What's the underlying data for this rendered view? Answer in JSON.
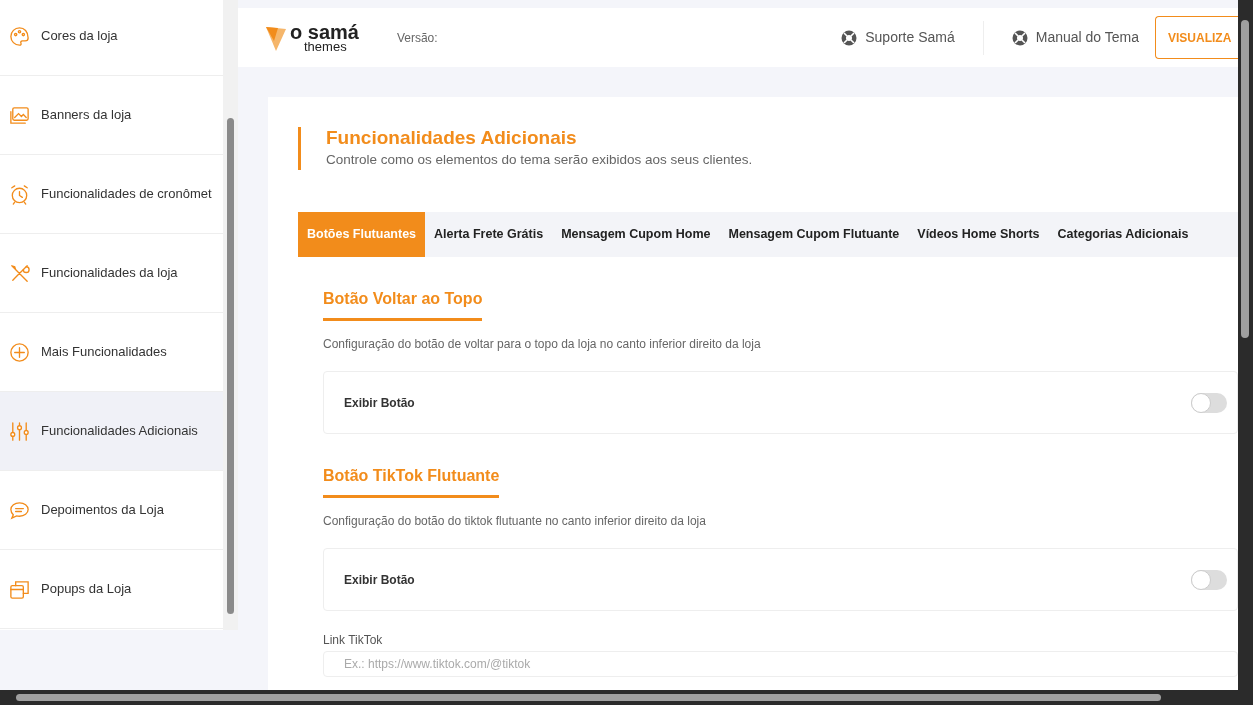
{
  "sidebar": {
    "items": [
      {
        "label": "Cores da loja",
        "selected": false
      },
      {
        "label": "Banners da loja",
        "selected": false
      },
      {
        "label": "Funcionalidades de cronômet",
        "selected": false
      },
      {
        "label": "Funcionalidades da loja",
        "selected": false
      },
      {
        "label": "Mais Funcionalidades",
        "selected": false
      },
      {
        "label": "Funcionalidades Adicionais",
        "selected": true
      },
      {
        "label": "Depoimentos da Loja",
        "selected": false
      },
      {
        "label": "Popups da Loja",
        "selected": false
      }
    ]
  },
  "header": {
    "logo": {
      "brand": "o samá",
      "sub": "themes"
    },
    "version_label": "Versão:",
    "links": [
      "Suporte Samá",
      "Manual do Tema"
    ],
    "preview_button": "VISUALIZA"
  },
  "page": {
    "title": "Funcionalidades Adicionais",
    "subtitle": "Controle como os elementos do tema serão exibidos aos seus clientes."
  },
  "tabs": [
    {
      "label": "Botões Flutuantes",
      "selected": true
    },
    {
      "label": "Alerta Frete Grátis",
      "selected": false
    },
    {
      "label": "Mensagem Cupom Home",
      "selected": false
    },
    {
      "label": "Mensagem Cupom Flutuante",
      "selected": false
    },
    {
      "label": "Vídeos Home Shorts",
      "selected": false
    },
    {
      "label": "Categorias Adicionais",
      "selected": false
    }
  ],
  "sections": [
    {
      "title": "Botão Voltar ao Topo",
      "description": "Configuração do botão de voltar para o topo da loja no canto inferior direito da loja",
      "toggle": {
        "label": "Exibir Botão",
        "on": false
      }
    },
    {
      "title": "Botão TikTok Flutuante",
      "description": "Configuração do botão do tiktok flutuante no canto inferior direito da loja",
      "toggle": {
        "label": "Exibir Botão",
        "on": false
      },
      "field": {
        "label": "Link TikTok",
        "placeholder": "Ex.: https://www.tiktok.com/@tiktok"
      }
    }
  ]
}
